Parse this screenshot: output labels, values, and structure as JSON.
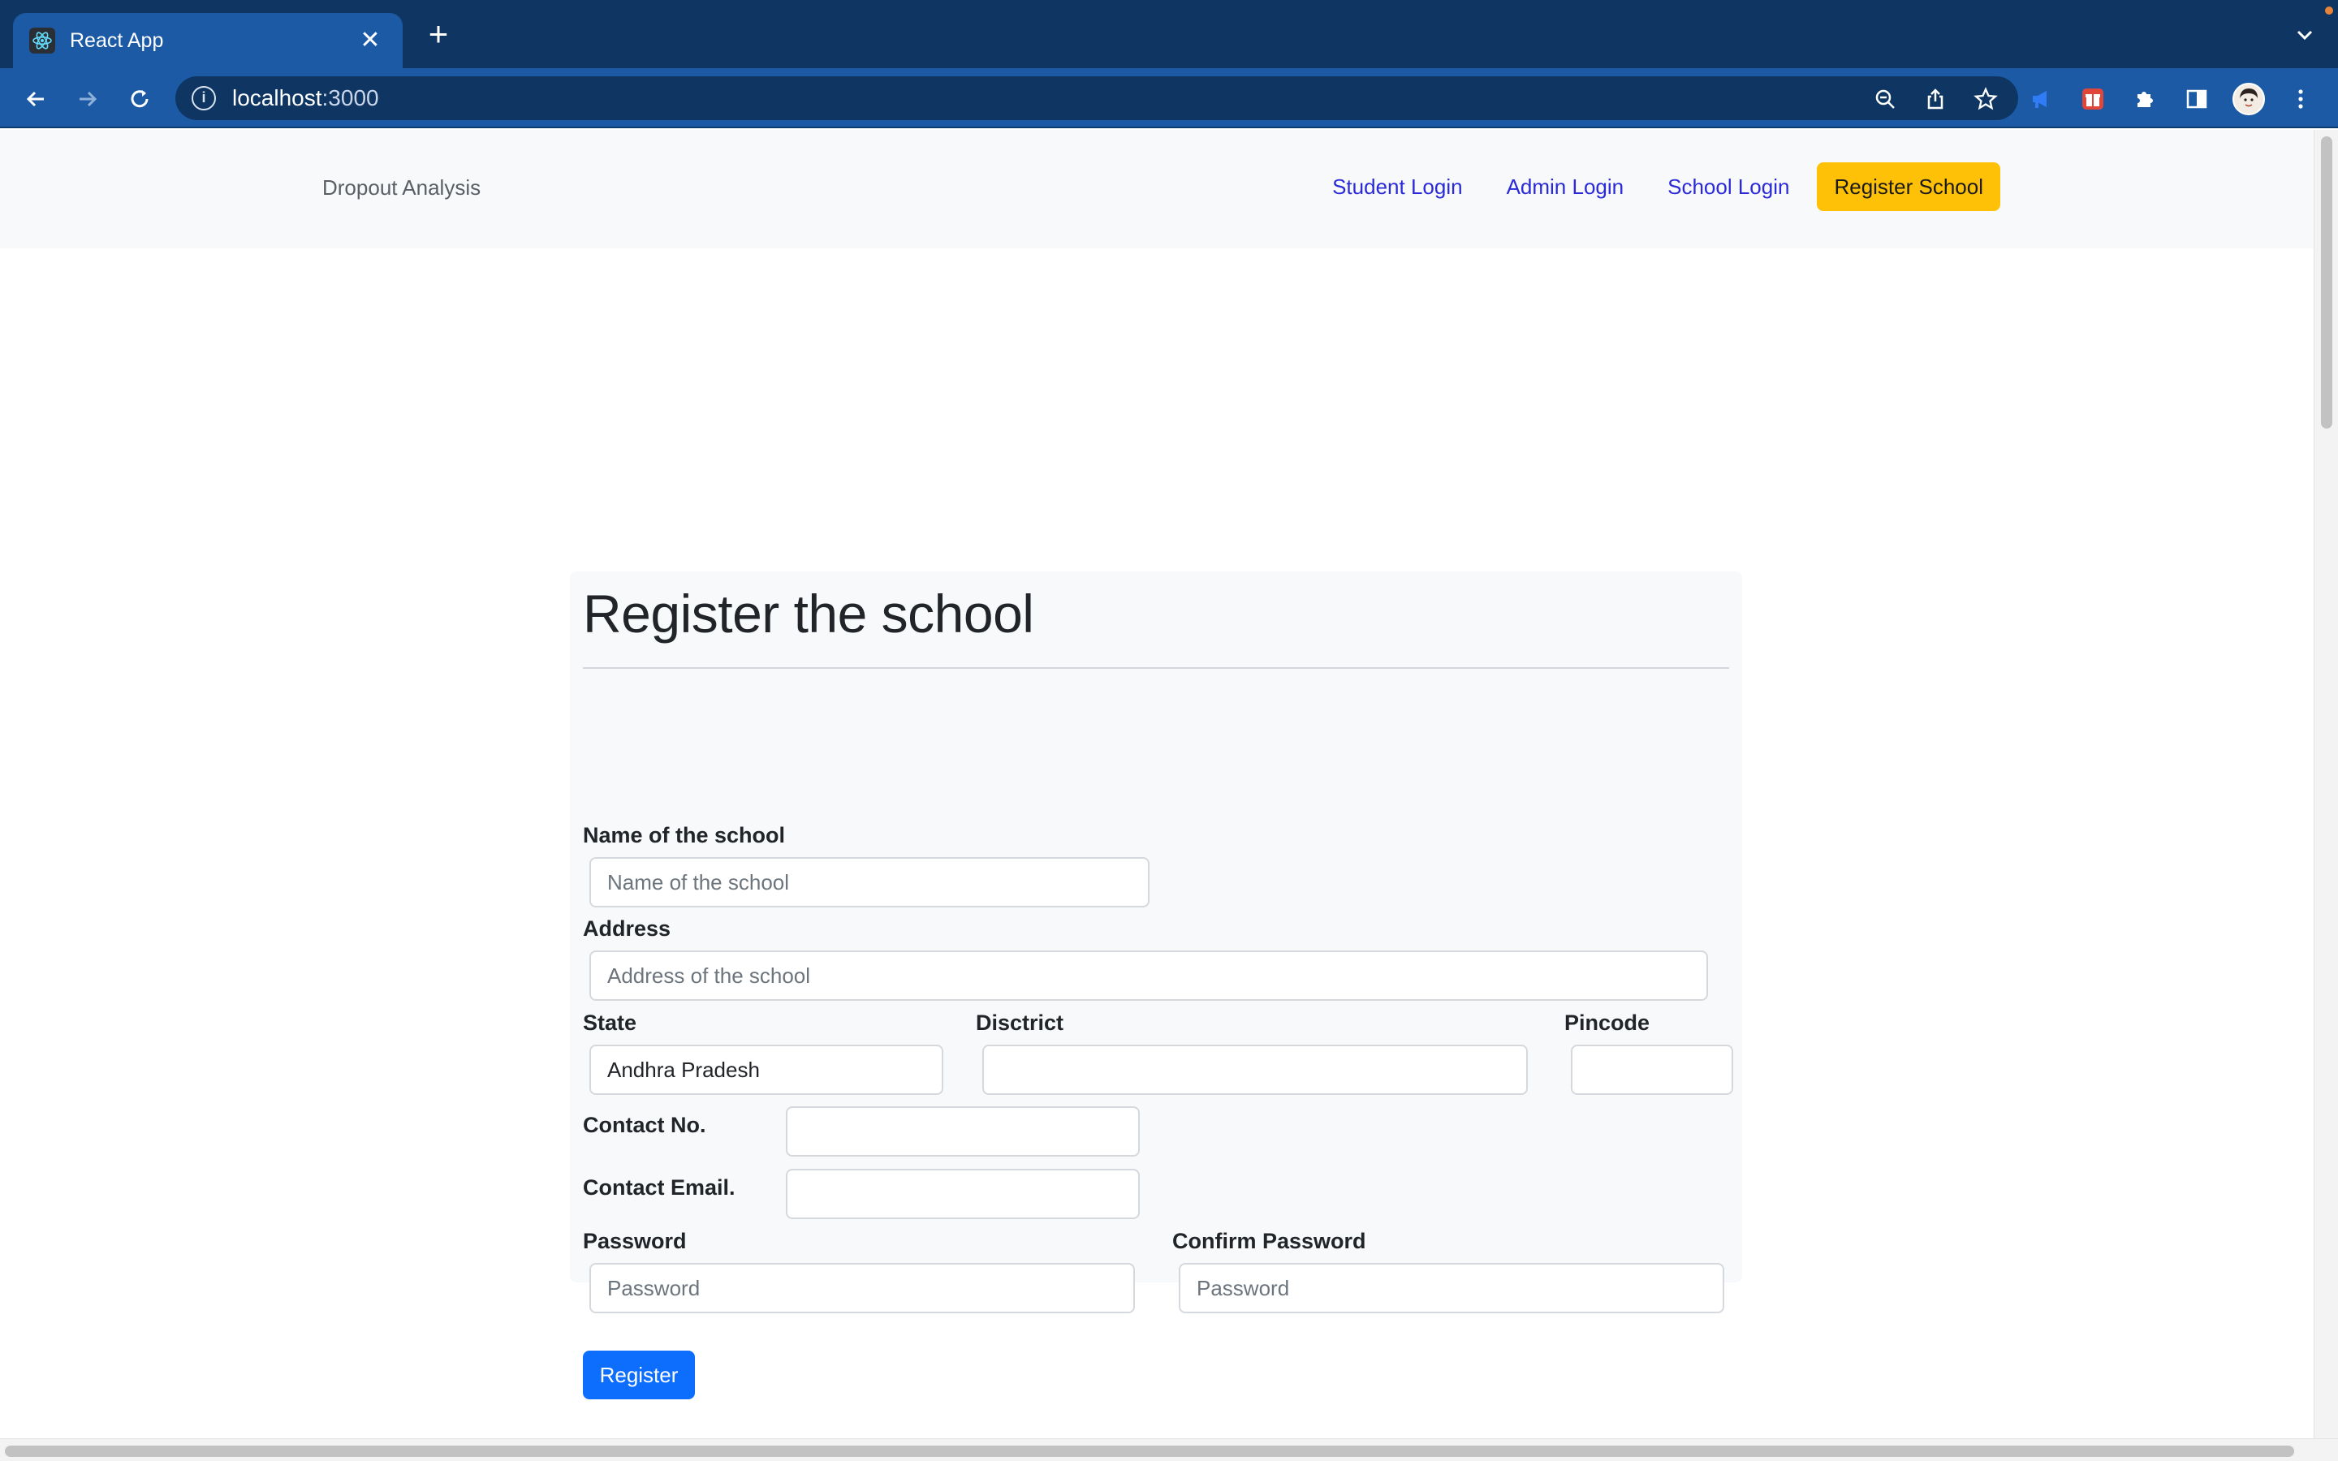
{
  "browser": {
    "tab_title": "React App",
    "url_host": "localhost",
    "url_port": ":3000",
    "accent": "#1c5aa6"
  },
  "navbar": {
    "brand": "Dropout Analysis",
    "links": [
      "Student Login",
      "Admin Login",
      "School Login"
    ],
    "cta": "Register School",
    "cta_color": "#ffc107"
  },
  "form": {
    "heading": "Register the school",
    "school_name": {
      "label": "Name of the school",
      "placeholder": "Name of the school"
    },
    "address": {
      "label": "Address",
      "placeholder": "Address of the school"
    },
    "state": {
      "label": "State",
      "value": "Andhra Pradesh"
    },
    "district": {
      "label": "Disctrict"
    },
    "pincode": {
      "label": "Pincode"
    },
    "contact_no": {
      "label": "Contact No."
    },
    "contact_email": {
      "label": "Contact Email."
    },
    "password": {
      "label": "Password",
      "placeholder": "Password"
    },
    "confirm_password": {
      "label": "Confirm Password",
      "placeholder": "Password"
    },
    "submit": "Register",
    "submit_color": "#0d6efd"
  }
}
